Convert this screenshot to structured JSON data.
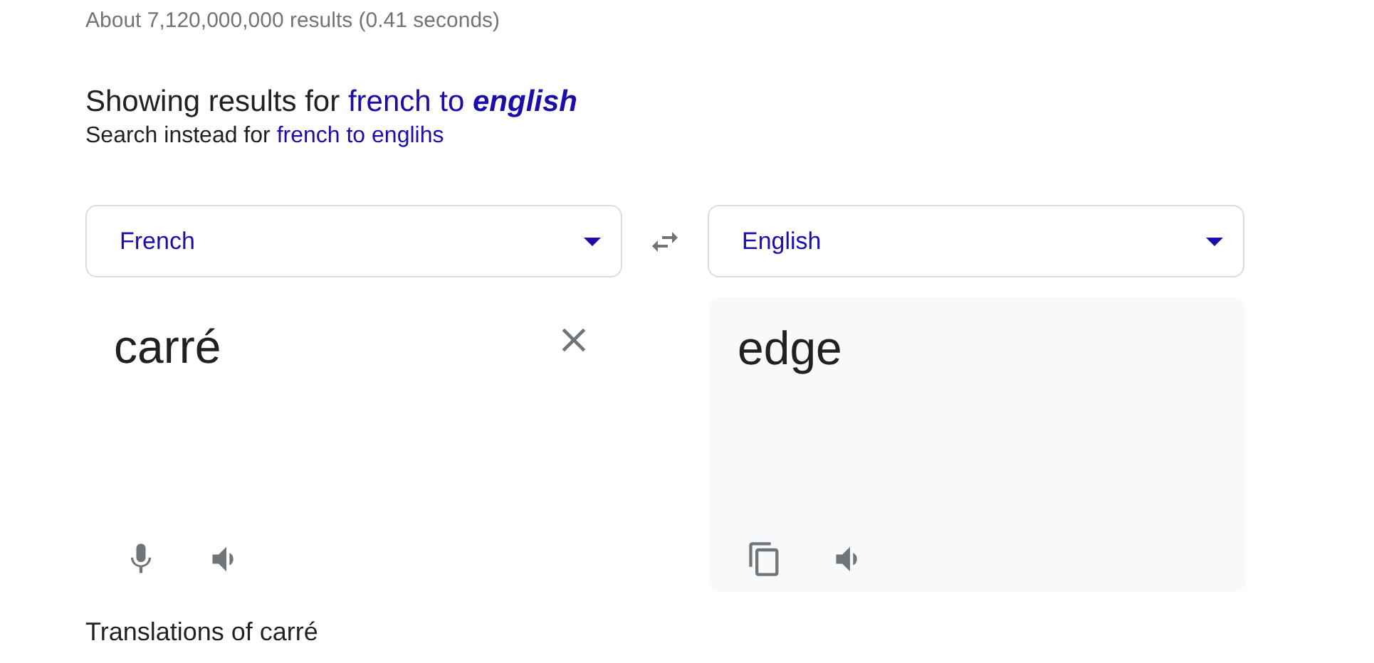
{
  "result_stats": "About 7,120,000,000 results (0.41 seconds)",
  "spelling": {
    "showing_prefix": "Showing results for",
    "showing_link": "french to **english**",
    "instead_prefix": "Search instead for",
    "instead_link": "french to englihs"
  },
  "source": {
    "language": "French",
    "text": "carré"
  },
  "target": {
    "language": "English",
    "text": "edge"
  },
  "translations_heading": "Translations of carré"
}
